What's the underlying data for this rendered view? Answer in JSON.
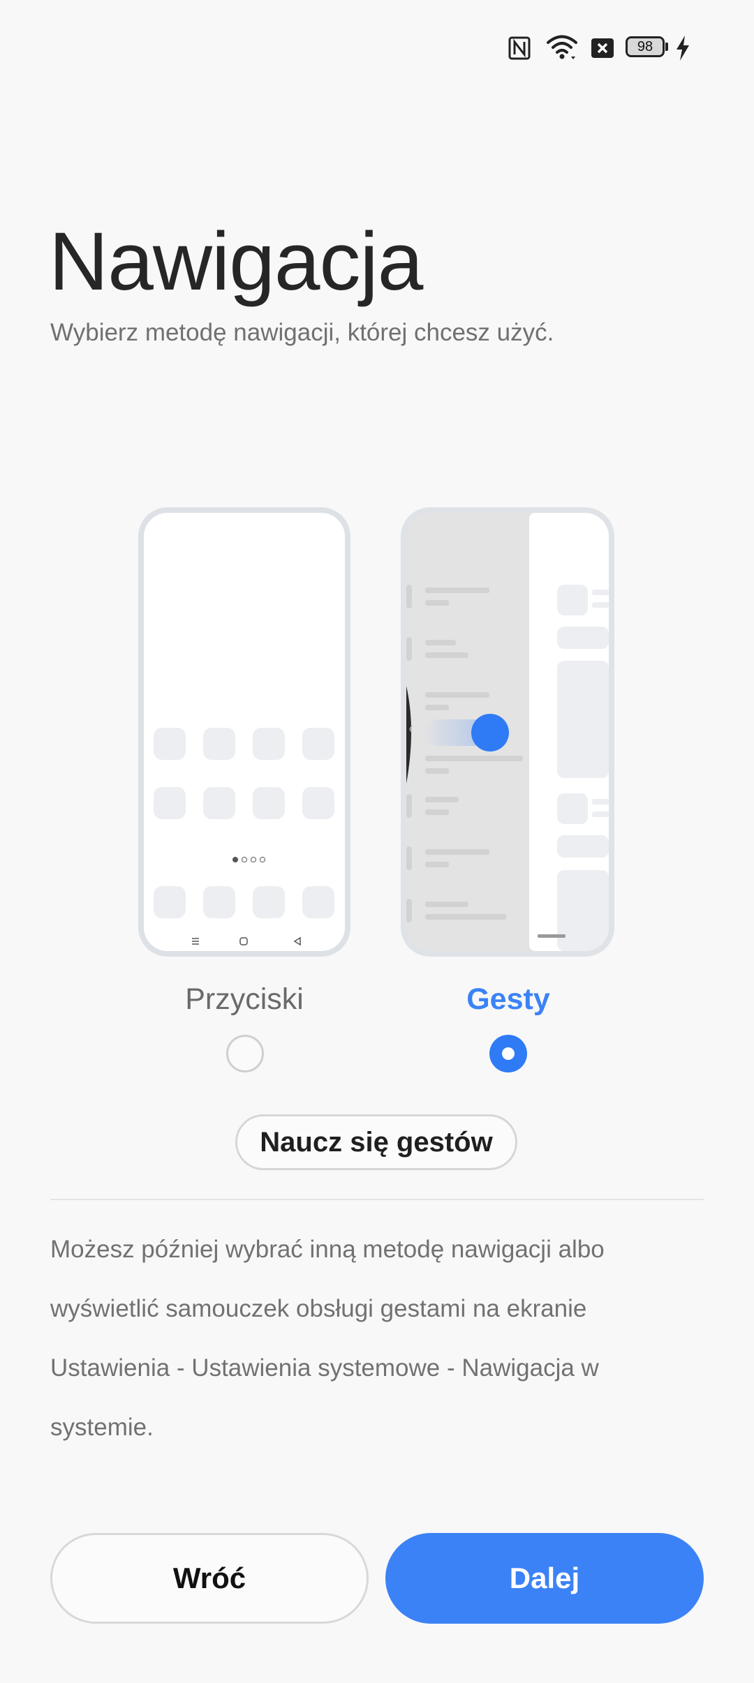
{
  "status_bar": {
    "icons": [
      "nfc-icon",
      "wifi-icon",
      "no-sim-icon",
      "battery-icon",
      "charging-icon"
    ],
    "battery_level": "98",
    "battery_fraction": 0.98
  },
  "header": {
    "title": "Nawigacja",
    "subtitle": "Wybierz metodę nawigacji, której chcesz użyć."
  },
  "options": [
    {
      "label": "Przyciski",
      "selected": false
    },
    {
      "label": "Gesty",
      "selected": true
    }
  ],
  "learn_button_label": "Naucz się gestów",
  "info_text": "Możesz później wybrać inną metodę nawigacji albo wyświetlić samouczek obsługi gestami na ekranie Ustawienia - Ustawienia systemowe - Nawigacja w systemie.",
  "footer": {
    "back_label": "Wróć",
    "next_label": "Dalej"
  },
  "colors": {
    "accent": "#3b82f6",
    "background": "#f8f8f8",
    "text_primary": "#262626",
    "text_secondary": "#707070"
  }
}
